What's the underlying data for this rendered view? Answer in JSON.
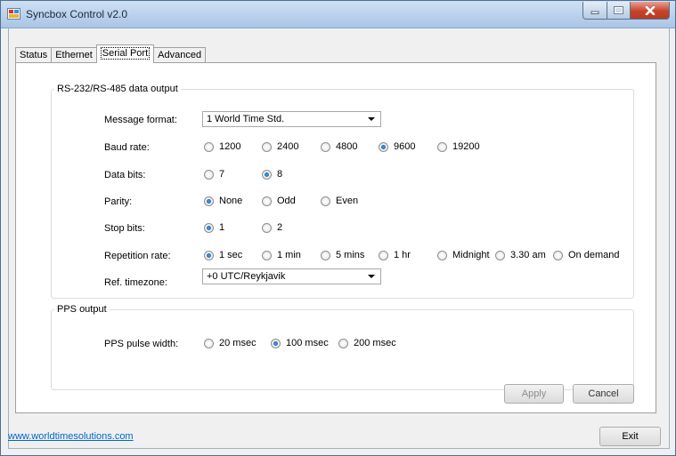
{
  "window": {
    "title": "Syncbox Control v2.0"
  },
  "tabs": [
    {
      "label": "Status"
    },
    {
      "label": "Ethernet"
    },
    {
      "label": "Serial Port"
    },
    {
      "label": "Advanced"
    }
  ],
  "serial_group": {
    "legend": "RS-232/RS-485 data output",
    "message_format": {
      "label": "Message format:",
      "value": "1 World Time Std."
    },
    "baud_rate": {
      "label": "Baud rate:",
      "options": [
        "1200",
        "2400",
        "4800",
        "9600",
        "19200"
      ],
      "selected": "9600"
    },
    "data_bits": {
      "label": "Data bits:",
      "options": [
        "7",
        "8"
      ],
      "selected": "8"
    },
    "parity": {
      "label": "Parity:",
      "options": [
        "None",
        "Odd",
        "Even"
      ],
      "selected": "None"
    },
    "stop_bits": {
      "label": "Stop bits:",
      "options": [
        "1",
        "2"
      ],
      "selected": "1"
    },
    "repetition_rate": {
      "label": "Repetition rate:",
      "options": [
        "1 sec",
        "1 min",
        "5 mins",
        "1 hr",
        "Midnight",
        "3.30 am",
        "On demand"
      ],
      "selected": "1 sec"
    },
    "ref_timezone": {
      "label": "Ref. timezone:",
      "value": "+0 UTC/Reykjavik"
    }
  },
  "pps_group": {
    "legend": "PPS output",
    "pulse_width": {
      "label": "PPS pulse width:",
      "options": [
        "20 msec",
        "100 msec",
        "200 msec"
      ],
      "selected": "100 msec"
    }
  },
  "buttons": {
    "apply": "Apply",
    "cancel": "Cancel",
    "exit": "Exit"
  },
  "footer": {
    "link": "www.worldtimesolutions.com"
  },
  "colors": {
    "link": "#0066cc",
    "radio_checked": "#0b4ea7",
    "close_button": "#c7432b"
  }
}
